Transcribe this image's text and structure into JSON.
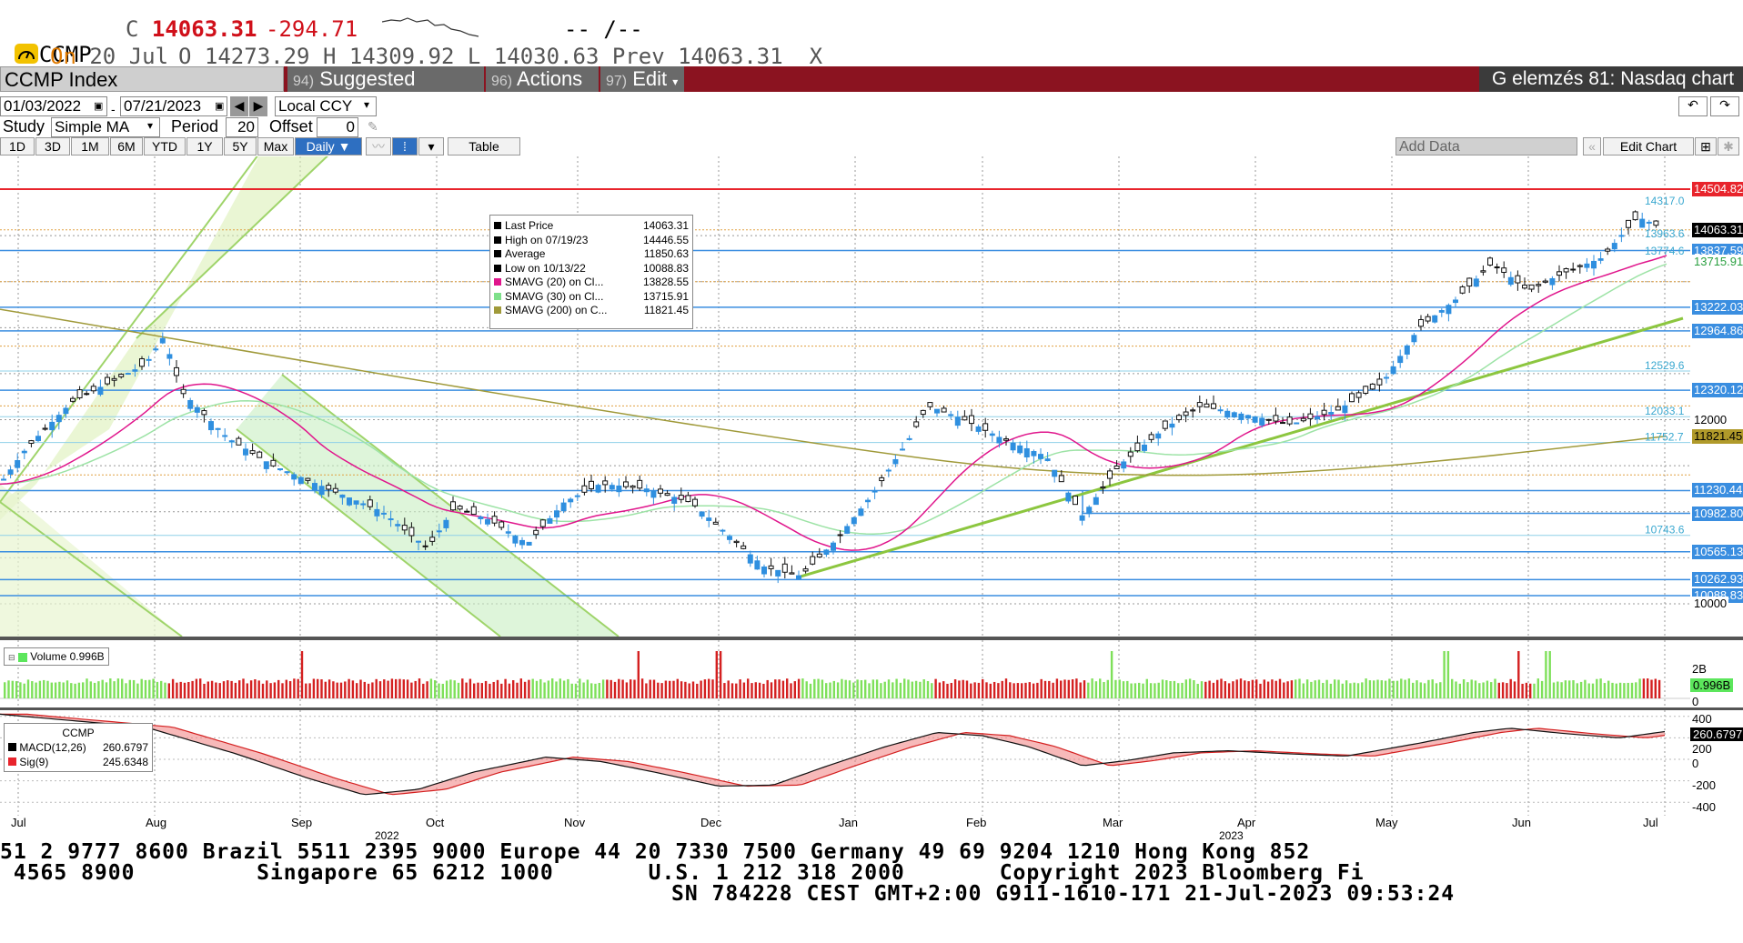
{
  "quote": {
    "ticker": "CCMP",
    "close_prefix": "C",
    "close": "14063.31",
    "change": "-294.71",
    "bid_ask": "-- /--",
    "date_label": "On",
    "date": "20 Jul",
    "open_label": "O",
    "open": "14273.29",
    "high_label": "H",
    "high": "14309.92",
    "low_label": "L",
    "low": "14030.63",
    "prev_label": "Prev",
    "prev": "14063.31",
    "close_x": "X"
  },
  "toolbar": {
    "index_name": "CCMP Index",
    "suggested_num": "94)",
    "suggested_label": "Suggested Charts",
    "actions_num": "96)",
    "actions_label": "Actions",
    "edit_num": "97)",
    "edit_label": "Edit",
    "chart_title": "G elemzés 81: Nasdaq chart"
  },
  "controls": {
    "start_date": "01/03/2022",
    "end_date": "07/21/2023",
    "currency": "Local CCY",
    "study_label": "Study",
    "study_value": "Simple MA",
    "period_label": "Period",
    "period_value": "20",
    "offset_label": "Offset",
    "offset_value": "0",
    "ranges": [
      "1D",
      "3D",
      "1M",
      "6M",
      "YTD",
      "1Y",
      "5Y",
      "Max"
    ],
    "frequency": "Daily",
    "table_label": "Table",
    "add_data_placeholder": "Add Data",
    "edit_chart_label": "Edit Chart"
  },
  "legend": {
    "rows": [
      {
        "label": "Last Price",
        "value": "14063.31",
        "color": "#000000"
      },
      {
        "label": "High on 07/19/23",
        "value": "14446.55",
        "color": "#000000"
      },
      {
        "label": "Average",
        "value": "11850.63",
        "color": "#000000"
      },
      {
        "label": "Low on 10/13/22",
        "value": "10088.83",
        "color": "#000000"
      },
      {
        "label": "SMAVG (20)   on Cl...",
        "value": "13828.55",
        "color": "#e0168c"
      },
      {
        "label": "SMAVG (30)   on Cl...",
        "value": "13715.91",
        "color": "#7ee08a"
      },
      {
        "label": "SMAVG (200)   on C...",
        "value": "11821.45",
        "color": "#a09a3a"
      }
    ]
  },
  "price_axis": {
    "tags": [
      {
        "value": "14504.82",
        "bg": "#e8242c",
        "fg": "#ffffff"
      },
      {
        "value": "14063.31",
        "bg": "#000000",
        "fg": "#ffffff"
      },
      {
        "value": "13837.59",
        "bg": "#3a8ee0",
        "fg": "#ffffff"
      },
      {
        "value": "13715.91",
        "bg": "#ffffff",
        "fg": "#2aa040"
      },
      {
        "value": "13222.03",
        "bg": "#3a8ee0",
        "fg": "#ffffff"
      },
      {
        "value": "12964.86",
        "bg": "#3a8ee0",
        "fg": "#ffffff"
      },
      {
        "value": "12320.12",
        "bg": "#3a8ee0",
        "fg": "#ffffff"
      },
      {
        "value": "12000",
        "bg": "#ffffff",
        "fg": "#000000"
      },
      {
        "value": "11821.45",
        "bg": "#b09a2a",
        "fg": "#000000"
      },
      {
        "value": "11230.44",
        "bg": "#3a8ee0",
        "fg": "#ffffff"
      },
      {
        "value": "10982.80",
        "bg": "#3a8ee0",
        "fg": "#ffffff"
      },
      {
        "value": "10565.13",
        "bg": "#3a8ee0",
        "fg": "#ffffff"
      },
      {
        "value": "10262.93",
        "bg": "#3a8ee0",
        "fg": "#ffffff"
      },
      {
        "value": "10088.83",
        "bg": "#3a8ee0",
        "fg": "#ffffff"
      },
      {
        "value": "10000",
        "bg": "#ffffff",
        "fg": "#000000"
      }
    ],
    "inline_labels": [
      "14317.0",
      "13963.6",
      "13774.6",
      "12529.6",
      "12033.1",
      "11752.7",
      "10743.6"
    ]
  },
  "volume": {
    "label": "Volume",
    "value": "0.996B",
    "axis": [
      "2B",
      "0.996B",
      "0"
    ]
  },
  "macd": {
    "title": "CCMP",
    "macd_label": "MACD(12,26)",
    "macd_value": "260.6797",
    "sig_label": "Sig(9)",
    "sig_value": "245.6348",
    "axis": [
      "400",
      "260.6797",
      "200",
      "0",
      "-200",
      "-400"
    ]
  },
  "x_axis": {
    "months": [
      "Jul",
      "Aug",
      "Sep",
      "Oct",
      "Nov",
      "Dec",
      "Jan",
      "Feb",
      "Mar",
      "Apr",
      "May",
      "Jun",
      "Jul"
    ],
    "years": [
      "2022",
      "2023"
    ]
  },
  "footer": {
    "line1": "51 2 9777 8600 Brazil 5511 2395 9000 Europe 44 20 7330 7500 Germany 49 69 9204 1210 Hong Kong 852",
    "line2": " 4565 8900         Singapore 65 6212 1000       U.S. 1 212 318 2000       Copyright 2023 Bloomberg Fi",
    "line3": "SN 784228 CEST GMT+2:00 G911-1610-171 21-Jul-2023 09:53:24"
  },
  "colors": {
    "accent_red": "#8b1320",
    "up": "#2f8fdf",
    "down": "#111111",
    "hline": "#3a8ee0",
    "trend": "#8cc63f",
    "sma20": "#e0168c",
    "sma30": "#9de3a6",
    "sma200": "#a09a3a"
  }
}
